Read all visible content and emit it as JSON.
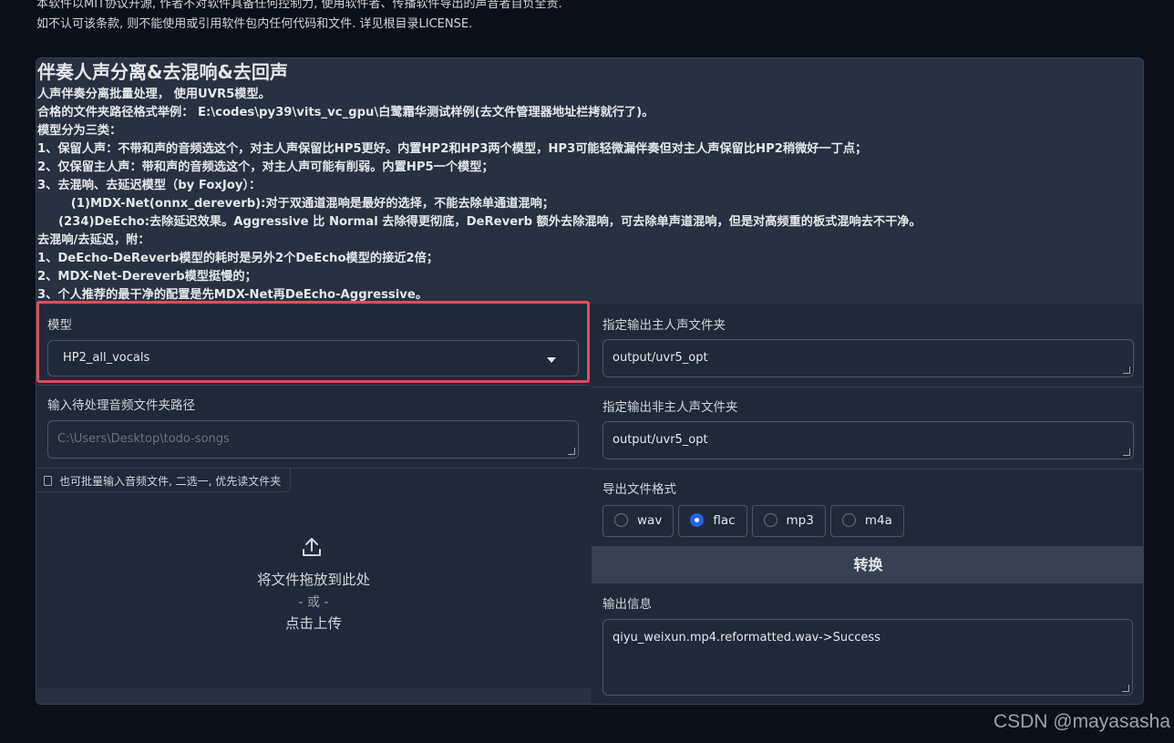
{
  "notice": {
    "line1": "本软件以MIT协议开源, 作者不对软件具备任何控制力, 使用软件者、传播软件导出的声音者自负全责.",
    "line2": "如不认可该条款, 则不能使用或引用软件包内任何代码和文件. 详见根目录LICENSE."
  },
  "description": {
    "title": "伴奏人声分离&去混响&去回声",
    "lines": [
      "人声伴奏分离批量处理， 使用UVR5模型。",
      "合格的文件夹路径格式举例： E:\\codes\\py39\\vits_vc_gpu\\白鹭霜华测试样例(去文件管理器地址栏拷就行了)。",
      "模型分为三类：",
      "1、保留人声：不带和声的音频选这个，对主人声保留比HP5更好。内置HP2和HP3两个模型，HP3可能轻微漏伴奏但对主人声保留比HP2稍微好一丁点；",
      "2、仅保留主人声：带和声的音频选这个，对主人声可能有削弱。内置HP5一个模型；",
      "3、去混响、去延迟模型（by FoxJoy）：",
      "        (1)MDX-Net(onnx_dereverb):对于双通道混响是最好的选择，不能去除单通道混响；",
      "     (234)DeEcho:去除延迟效果。Aggressive 比 Normal 去除得更彻底，DeReverb 额外去除混响，可去除单声道混响，但是对高频重的板式混响去不干净。",
      "去混响/去延迟，附：",
      "1、DeEcho-DeReverb模型的耗时是另外2个DeEcho模型的接近2倍；",
      "2、MDX-Net-Dereverb模型挺慢的；",
      "3、个人推荐的最干净的配置是先MDX-Net再DeEcho-Aggressive。"
    ]
  },
  "model": {
    "label": "模型",
    "selected": "HP2_all_vocals"
  },
  "input_path": {
    "label": "输入待处理音频文件夹路径",
    "placeholder": "C:\\Users\\Desktop\\todo-songs"
  },
  "upload": {
    "tag": "也可批量输入音频文件, 二选一, 优先读文件夹",
    "drop_text": "将文件拖放到此处",
    "or_text": "- 或 -",
    "click_text": "点击上传"
  },
  "vocal_output": {
    "label": "指定输出主人声文件夹",
    "value": "output/uvr5_opt"
  },
  "other_output": {
    "label": "指定输出非主人声文件夹",
    "value": "output/uvr5_opt"
  },
  "format": {
    "label": "导出文件格式",
    "options": [
      "wav",
      "flac",
      "mp3",
      "m4a"
    ],
    "selected": "flac"
  },
  "convert_button": "转换",
  "output_info": {
    "label": "输出信息",
    "value": "qiyu_weixun.mp4.reformatted.wav->Success"
  },
  "watermark": "CSDN @mayasasha",
  "colors": {
    "background": "#0b0f19",
    "panel": "#1f2937",
    "highlight": "#e24b5b",
    "radio_selected": "#2563eb"
  }
}
